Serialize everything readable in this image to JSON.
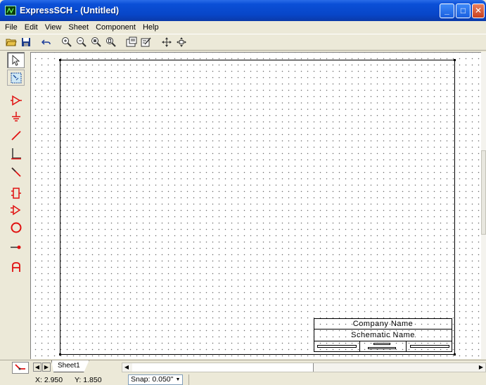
{
  "window": {
    "title": "ExpressSCH - (Untitled)",
    "icons": {
      "app": "schematic-app-icon",
      "minimize": "minimize-icon",
      "maximize": "maximize-icon",
      "close": "close-icon"
    }
  },
  "menu": {
    "items": [
      "File",
      "Edit",
      "View",
      "Sheet",
      "Component",
      "Help"
    ]
  },
  "toolbar": {
    "buttons": [
      "open-folder-icon",
      "save-disk-icon",
      "undo-icon",
      "zoom-in-icon",
      "zoom-out-icon",
      "zoom-area-icon",
      "zoom-fit-icon",
      "properties-icon",
      "edit-properties-icon",
      "pan-icon",
      "pan-center-icon"
    ]
  },
  "palette": {
    "tools": [
      "select-arrow-icon",
      "zoom-window-icon",
      "component-icon",
      "ground-icon",
      "wire-icon",
      "bus-icon",
      "bus-entry-icon",
      "connector-icon",
      "port-icon",
      "circle-icon",
      "pin-icon",
      "text-icon"
    ]
  },
  "titleblock": {
    "company": "Company Name",
    "schematic": "Schematic Name"
  },
  "tabs": {
    "sheets": [
      "Sheet1"
    ]
  },
  "status": {
    "x_label": "X: 2.950",
    "y_label": "Y: 1.850",
    "snap": "Snap: 0.050\""
  },
  "colors": {
    "accent_red": "#e01010",
    "title_blue": "#0a4fd7"
  }
}
